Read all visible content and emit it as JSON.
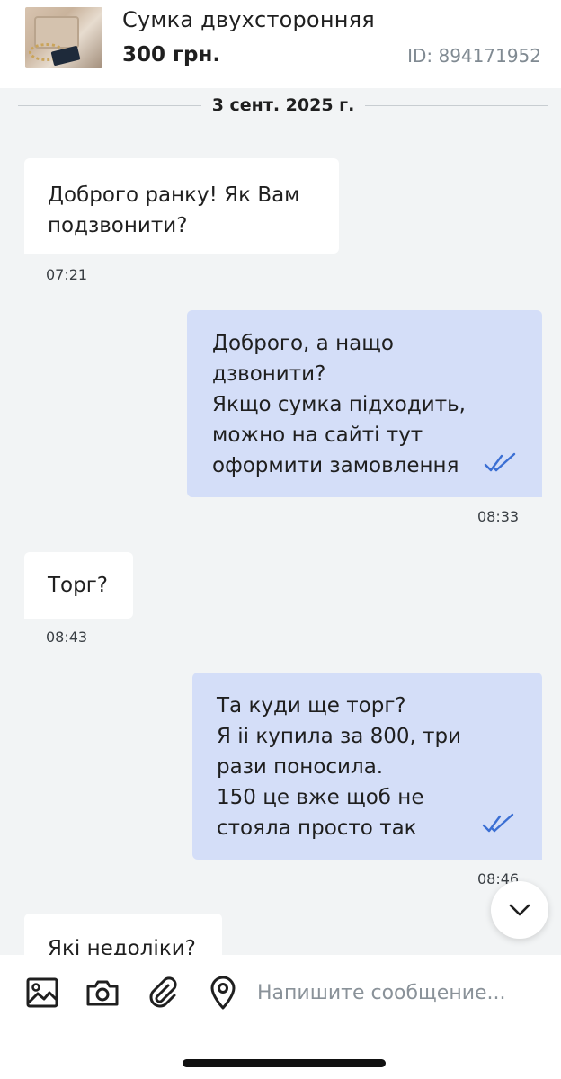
{
  "header": {
    "title": "Сумка двухсторонняя",
    "price": "300 грн.",
    "ad_id": "ID: 894171952",
    "thumbnail_icon": "bag-photo"
  },
  "date_divider": "3 сент. 2025 г.",
  "messages": [
    {
      "direction": "in",
      "text": "Доброго ранку! Як Вам\nподзвонити?",
      "time": "07:21"
    },
    {
      "direction": "out",
      "text": "Доброго, а нащо\nдзвонити?\nЯкщо сумка підходить,\nможно на сайті тут\nоформити замовлення",
      "time": "08:33",
      "status_icon": "double-check"
    },
    {
      "direction": "in",
      "text": "Торг?",
      "time": "08:43"
    },
    {
      "direction": "out",
      "text": "Та куди ще торг?\nЯ іі купила за 800, три\nрази поносила.\n150 це вже щоб не\nстояла просто так",
      "time": "08:46",
      "status_icon": "double-check"
    },
    {
      "direction": "in",
      "text": "Які недоліки?",
      "time": ""
    }
  ],
  "composer": {
    "placeholder": "Напишите сообщение...",
    "tools": [
      "image-icon",
      "camera-icon",
      "paperclip-icon",
      "location-pin-icon"
    ]
  },
  "colors": {
    "incoming_bubble": "#ffffff",
    "outgoing_bubble": "#d4def8",
    "check_marks": "#3b6fd4",
    "background": "#f2f4f5"
  }
}
